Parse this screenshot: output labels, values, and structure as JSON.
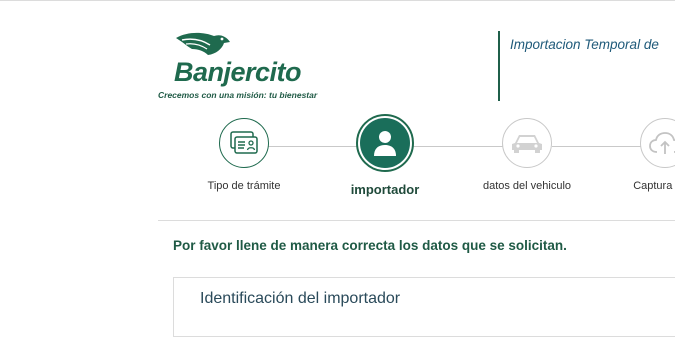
{
  "brand": {
    "name": "Banjercito",
    "tagline": "Crecemos con una misión: tu bienestar",
    "color": "#1f6a4e"
  },
  "header": {
    "title": "Importacion Temporal de"
  },
  "steps": [
    {
      "label": "Tipo de trámite",
      "icon": "id-card-icon",
      "state": "done"
    },
    {
      "label": "importador",
      "icon": "person-icon",
      "state": "active"
    },
    {
      "label": "datos del vehiculo",
      "icon": "car-icon",
      "state": "pending"
    },
    {
      "label": "Captura de d",
      "icon": "cloud-upload-icon",
      "state": "pending"
    }
  ],
  "instructions": "Por favor llene de manera correcta los datos que se solicitan.",
  "section": {
    "title": "Identificación del importador"
  }
}
